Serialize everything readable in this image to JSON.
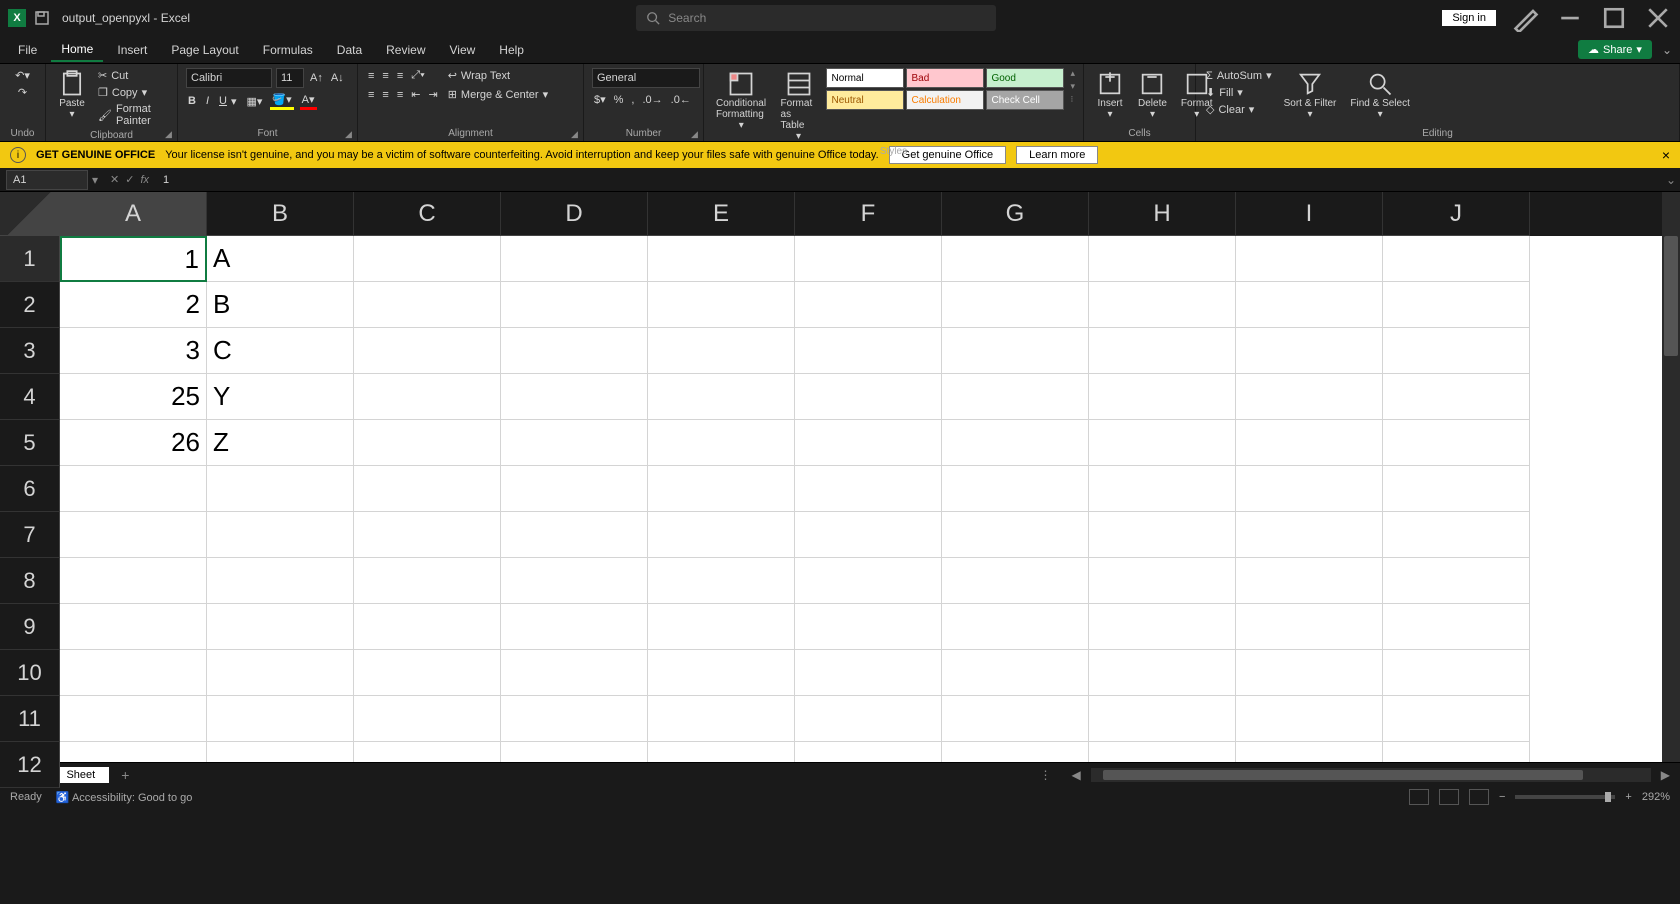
{
  "title": {
    "filename": "output_openpyxl",
    "app": "Excel"
  },
  "search": {
    "placeholder": "Search"
  },
  "signin": "Sign in",
  "tabs": [
    "File",
    "Home",
    "Insert",
    "Page Layout",
    "Formulas",
    "Data",
    "Review",
    "View",
    "Help"
  ],
  "active_tab": "Home",
  "share": "Share",
  "ribbon": {
    "undo": "Undo",
    "clipboard": {
      "paste": "Paste",
      "cut": "Cut",
      "copy": "Copy",
      "painter": "Format Painter",
      "label": "Clipboard"
    },
    "font": {
      "name": "Calibri",
      "size": "11",
      "label": "Font"
    },
    "alignment": {
      "wrap": "Wrap Text",
      "merge": "Merge & Center",
      "label": "Alignment"
    },
    "number": {
      "format": "General",
      "label": "Number"
    },
    "styles": {
      "cond": "Conditional Formatting",
      "table": "Format as Table",
      "cells": [
        "Normal",
        "Bad",
        "Good",
        "Neutral",
        "Calculation",
        "Check Cell"
      ],
      "label": "Styles"
    },
    "cells_group": {
      "insert": "Insert",
      "delete": "Delete",
      "format": "Format",
      "label": "Cells"
    },
    "editing": {
      "autosum": "AutoSum",
      "fill": "Fill",
      "clear": "Clear",
      "sort": "Sort & Filter",
      "find": "Find & Select",
      "label": "Editing"
    }
  },
  "warning": {
    "title": "GET GENUINE OFFICE",
    "msg": "Your license isn't genuine, and you may be a victim of software counterfeiting. Avoid interruption and keep your files safe with genuine Office today.",
    "btn1": "Get genuine Office",
    "btn2": "Learn more"
  },
  "namebox": "A1",
  "formula": "1",
  "columns": [
    "A",
    "B",
    "C",
    "D",
    "E",
    "F",
    "G",
    "H",
    "I",
    "J"
  ],
  "rows": [
    "1",
    "2",
    "3",
    "4",
    "5",
    "6",
    "7",
    "8",
    "9",
    "10",
    "11",
    "12"
  ],
  "selected_cell": {
    "row": 0,
    "col": 0
  },
  "data": {
    "A": [
      "1",
      "2",
      "3",
      "25",
      "26"
    ],
    "B": [
      "A",
      "B",
      "C",
      "Y",
      "Z"
    ]
  },
  "sheet": {
    "name": "Sheet"
  },
  "status": {
    "ready": "Ready",
    "access": "Accessibility: Good to go",
    "zoom": "292%"
  }
}
